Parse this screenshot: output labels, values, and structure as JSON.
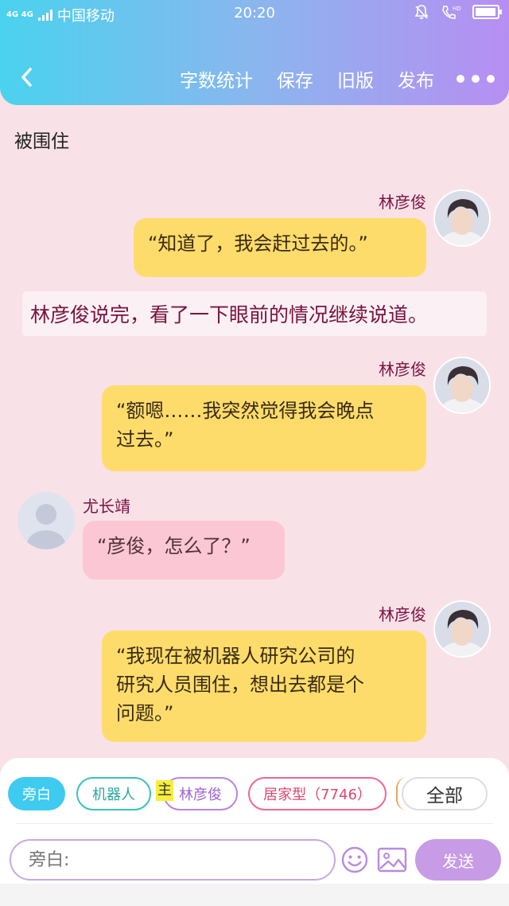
{
  "status_bar": {
    "network": "4G 4G",
    "carrier": "中国移动",
    "time": "20:20",
    "battery_level": 0.95
  },
  "nav": {
    "actions": [
      "字数统计",
      "保存",
      "旧版",
      "发布"
    ]
  },
  "chapter_title": "被围住",
  "messages": [
    {
      "speaker": "林彦俊",
      "text": "“知道了，我会赶过去的。”"
    },
    {
      "narration": "林彦俊说完，看了一下眼前的情况继续说道。"
    },
    {
      "speaker": "林彦俊",
      "lines": [
        "“额嗯……我突然觉得我会晚点",
        "过去。”"
      ]
    },
    {
      "speaker": "尤长靖",
      "text": "“彦俊，怎么了？”"
    },
    {
      "speaker": "林彦俊",
      "lines": [
        "“我现在被机器人研究公司的",
        "研究人员围住，想出去都是个",
        "问题。”"
      ]
    }
  ],
  "chips": {
    "narration": "旁白",
    "robot": "机器人",
    "main_tag": "主",
    "lin": "林彦俊",
    "home": "居家型（7746）",
    "all": "全部"
  },
  "input": {
    "placeholder": "旁白:",
    "send_label": "发送"
  },
  "colors": {
    "header_gradient": [
      "#4ad2ee",
      "#b78ef2"
    ],
    "background": "#f9e1e8",
    "bubble_yellow": "#fedc6b",
    "bubble_pink": "#fcc7d4",
    "name_color": "#7b1242"
  }
}
